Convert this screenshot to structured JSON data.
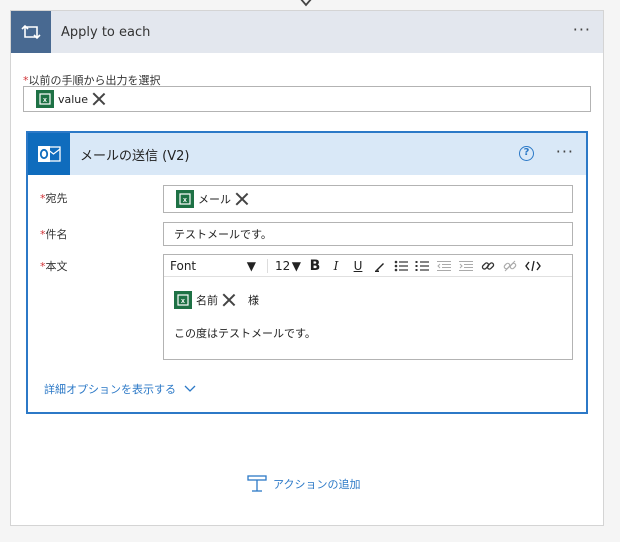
{
  "outer": {
    "title": "Apply to each",
    "more": "···"
  },
  "select_field": {
    "required_mark": "*",
    "label": "以前の手順から出力を選択",
    "token": "value"
  },
  "card": {
    "title": "メールの送信 (V2)",
    "help": "?",
    "more": "···",
    "to": {
      "required_mark": "*",
      "label": "宛先",
      "token": "メール"
    },
    "subject": {
      "required_mark": "*",
      "label": "件名",
      "value": "テストメールです。"
    },
    "body": {
      "required_mark": "*",
      "label": "本文",
      "font": "Font",
      "size": "12",
      "bold": "B",
      "italic": "I",
      "underline": "U",
      "token": "名前",
      "after_token": "様",
      "line2": "この度はテストメールです。"
    },
    "advanced_options": "詳細オプションを表示する"
  },
  "add_action": "アクションの追加",
  "colors": {
    "accent": "#2c79c7",
    "loop_tile": "#486991",
    "outlook_tile": "#0f6cbd",
    "excel": "#1e7145",
    "required": "#d13438"
  }
}
